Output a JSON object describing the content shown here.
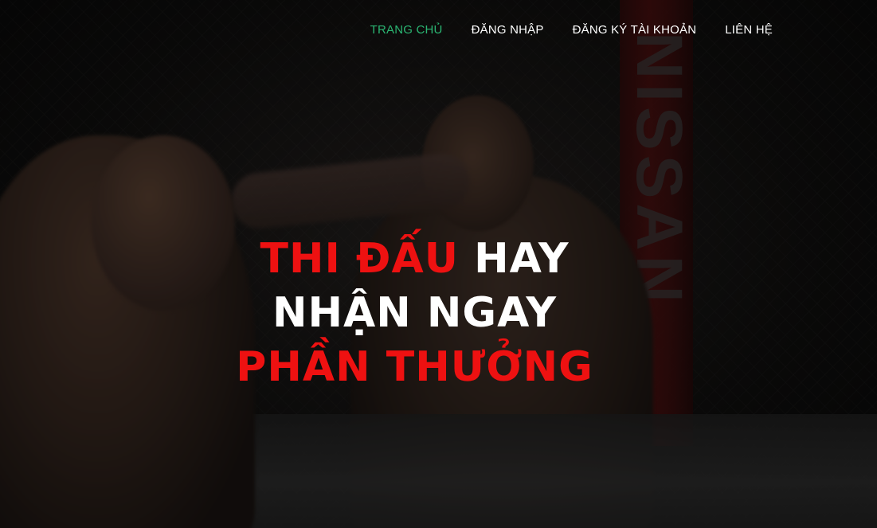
{
  "nav": {
    "items": [
      {
        "label": "TRANG CHỦ",
        "active": true
      },
      {
        "label": "ĐĂNG NHẬP",
        "active": false
      },
      {
        "label": "ĐĂNG KÝ TÀI KHOẢN",
        "active": false
      },
      {
        "label": "LIÊN HỆ",
        "active": false
      }
    ]
  },
  "hero": {
    "headline": {
      "line1_red": "THI ĐẤU",
      "line1_white": "HAY",
      "line2_white": "NHẬN NGAY",
      "line3_red": "PHẦN THƯỞNG"
    },
    "background": {
      "sponsor_banner": "NISSAN"
    }
  },
  "colors": {
    "accent_active": "#2bb673",
    "headline_red": "#ee1111",
    "text_white": "#ffffff"
  }
}
